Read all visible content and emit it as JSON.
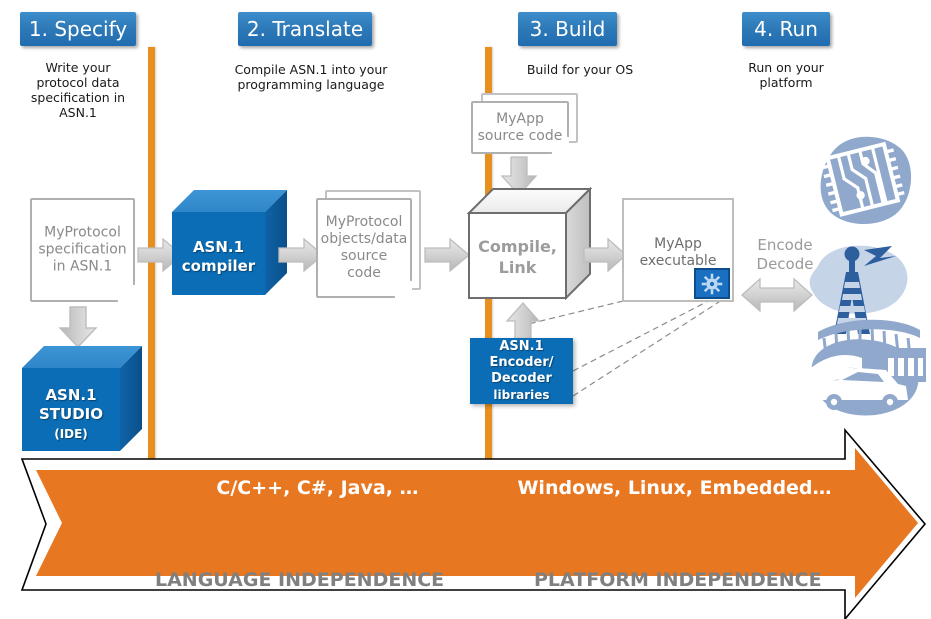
{
  "diagram": {
    "title": "ASN.1 development workflow",
    "colors": {
      "step_blue": "#2f7ab8",
      "accent_blue": "#0b6db5",
      "orange": "#e8901f",
      "band_orange": "#e87722",
      "gray_text": "#8a8a8a",
      "dark_gray_text": "#808080",
      "illustration_blue": "#8fa8cc",
      "illustration_dark_blue": "#2d5f9e"
    },
    "steps": [
      {
        "chip": "1. Specify",
        "caption": "Write your\nprotocol data\nspecification in\nASN.1"
      },
      {
        "chip": "2. Translate",
        "caption": "Compile  ASN.1 into your\nprogramming  language"
      },
      {
        "chip": "3. Build",
        "caption": "Build  for your OS"
      },
      {
        "chip": "4. Run",
        "caption": "Run on your\nplatform"
      }
    ],
    "nodes": {
      "my_protocol_spec": {
        "label": "MyProtocol\nspecification\nin  ASN.1",
        "shape": "document"
      },
      "asn1_studio": {
        "line1": "ASN.1",
        "line2": "STUDIO",
        "line3": "(IDE)",
        "shape": "cube-blue"
      },
      "asn1_compiler": {
        "line1": "ASN.1",
        "line2": "compiler",
        "shape": "cube-blue"
      },
      "my_protocol_objects": {
        "label": "MyProtocol\nobjects/data\nsource\ncode",
        "shape": "document-stack"
      },
      "myapp_source": {
        "label": "MyApp\nsource code",
        "shape": "document-stack"
      },
      "compile_link": {
        "line1": "Compile,",
        "line2": "Link",
        "shape": "cube-gray"
      },
      "myapp_executable": {
        "label": "MyApp\nexecutable",
        "shape": "rect",
        "badge_icon": "gear-icon"
      },
      "asn1_libraries": {
        "line1": "ASN.1",
        "line2": "Encoder/",
        "line3": "Decoder",
        "line4": "libraries",
        "shape": "flat-blue"
      },
      "encode_decode": {
        "line1": "Encode",
        "line2": "Decode",
        "icon": "double-arrow-icon"
      }
    },
    "illustrations": [
      {
        "name": "circuit-board-icon",
        "alt": "microchip circuit board"
      },
      {
        "name": "radio-tower-icon",
        "alt": "radio transmission tower"
      },
      {
        "name": "car-traffic-icon",
        "alt": "car and roadway"
      }
    ],
    "band": {
      "left_label": "C/C++, C#, Java, …",
      "right_label": "Windows, Linux, Embedded…",
      "left_footer": "LANGUAGE INDEPENDENCE",
      "right_footer": "PLATFORM INDEPENDENCE"
    }
  }
}
